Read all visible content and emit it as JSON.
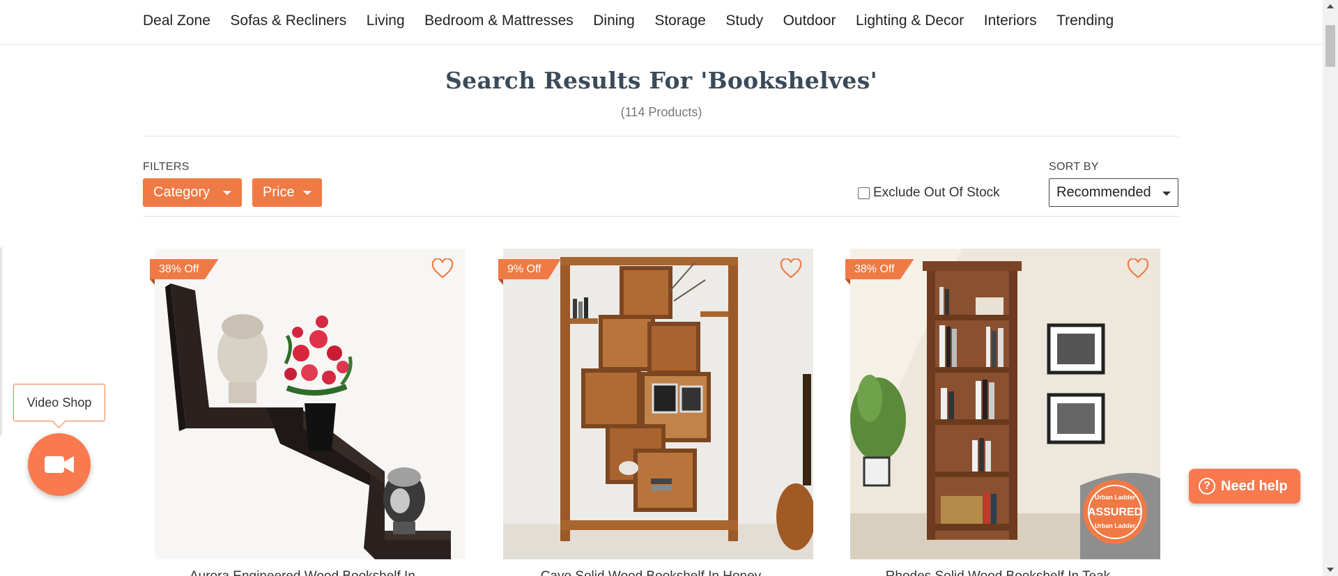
{
  "nav": {
    "items": [
      "Deal Zone",
      "Sofas & Recliners",
      "Living",
      "Bedroom & Mattresses",
      "Dining",
      "Storage",
      "Study",
      "Outdoor",
      "Lighting & Decor",
      "Interiors",
      "Trending"
    ]
  },
  "search": {
    "title": "Search Results For 'Bookshelves'",
    "count": "(114 Products)"
  },
  "filters": {
    "label": "FILTERS",
    "category": "Category",
    "price": "Price",
    "exclude_out_of_stock": "Exclude Out Of Stock",
    "exclude_checked": false
  },
  "sort": {
    "label": "SORT BY",
    "selected": "Recommended"
  },
  "products": [
    {
      "discount": "38% Off",
      "name": "Aurora Engineered Wood Bookshelf In ..."
    },
    {
      "discount": "9% Off",
      "name": "Cayo Solid Wood Bookshelf In Honey ..."
    },
    {
      "discount": "38% Off",
      "name": "Rhodes Solid Wood Bookshelf In Teak ..."
    }
  ],
  "assured_badge": {
    "line1": "Urban Ladder",
    "line2": "ASSURED",
    "line3": "Urban Ladder"
  },
  "widgets": {
    "video_shop": "Video Shop",
    "need_help": "Need help"
  },
  "colors": {
    "accent": "#f07a45",
    "title": "#3a4a5a"
  }
}
